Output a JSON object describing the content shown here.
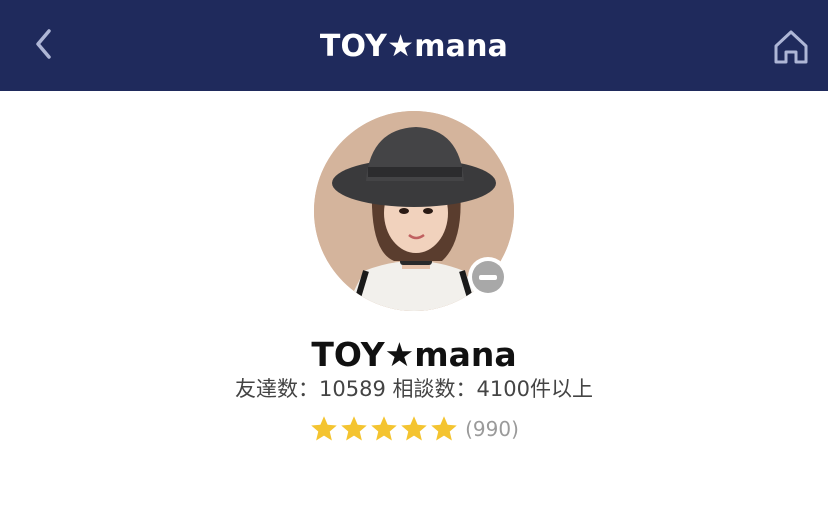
{
  "header": {
    "title": "TOY★mana",
    "back_icon": "chevron-left-icon",
    "home_icon": "home-icon",
    "background_color": "#1f2a5c"
  },
  "profile": {
    "name": "TOY★mana",
    "stats_text": "友達数：10589 相談数：4100件以上",
    "status": "offline",
    "rating": {
      "stars": 5,
      "max_stars": 5,
      "count_text": "(990)",
      "star_color": "#f4c430"
    }
  }
}
